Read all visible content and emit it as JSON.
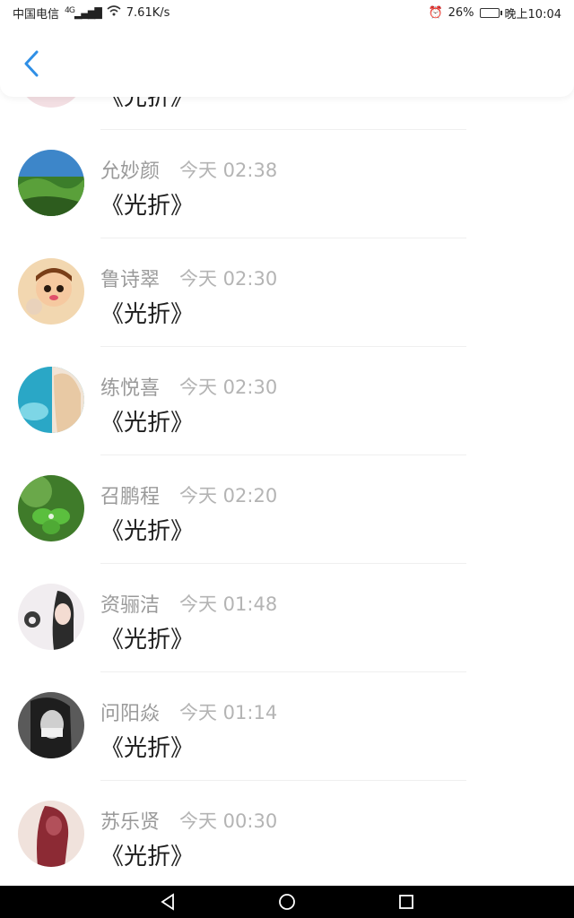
{
  "status_bar": {
    "carrier": "中国电信",
    "network": "4G",
    "speed": "7.61K/s",
    "battery": "26%",
    "time": "晚上10:04"
  },
  "header": {
    "back_icon": "chevron-left-icon"
  },
  "messages": [
    {
      "name": "",
      "time": "",
      "content": "《光折》"
    },
    {
      "name": "允妙颜",
      "time": "今天 02:38",
      "content": "《光折》"
    },
    {
      "name": "鲁诗翠",
      "time": "今天 02:30",
      "content": "《光折》"
    },
    {
      "name": "练悦喜",
      "time": "今天 02:30",
      "content": "《光折》"
    },
    {
      "name": "召鹏程",
      "time": "今天 02:20",
      "content": "《光折》"
    },
    {
      "name": "资骊洁",
      "time": "今天 01:48",
      "content": "《光折》"
    },
    {
      "name": "问阳焱",
      "time": "今天 01:14",
      "content": "《光折》"
    },
    {
      "name": "苏乐贤",
      "time": "今天 00:30",
      "content": "《光折》"
    }
  ],
  "nav": {
    "back": "triangle-back-icon",
    "home": "circle-home-icon",
    "recents": "square-recents-icon"
  },
  "colors": {
    "accent": "#2f8fe6",
    "name": "#9a9a9a",
    "time": "#b4b4b4",
    "content": "#1e1e1e"
  }
}
